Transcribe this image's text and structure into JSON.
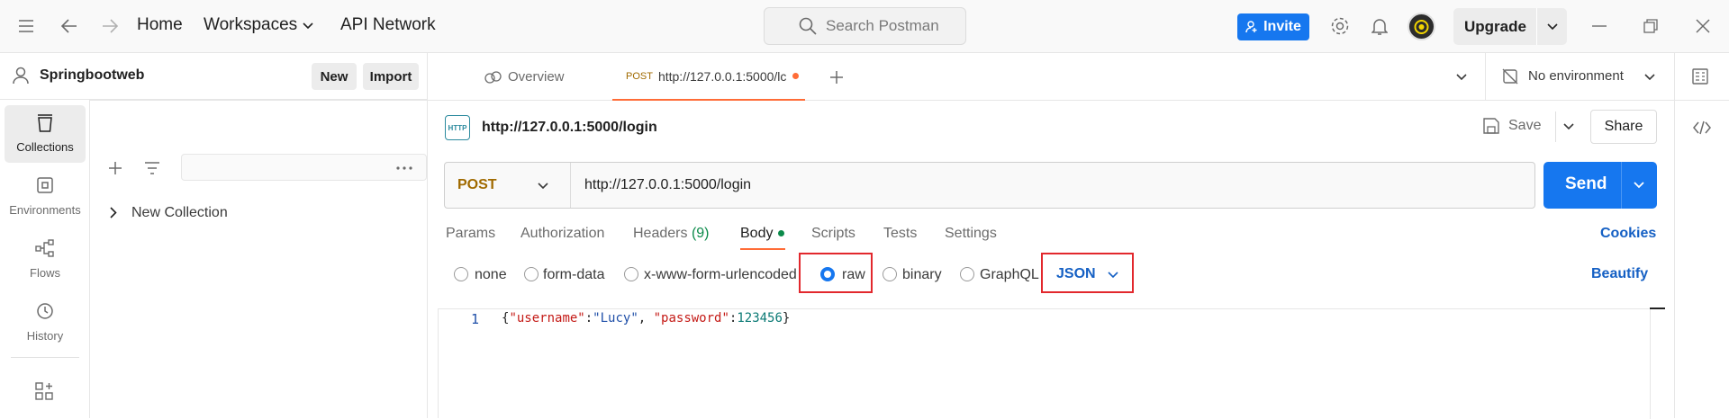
{
  "topbar": {
    "nav": {
      "home": "Home",
      "workspaces": "Workspaces",
      "api_network": "API Network"
    },
    "search_placeholder": "Search Postman",
    "invite": "Invite",
    "upgrade": "Upgrade"
  },
  "rail": {
    "items": [
      {
        "label": "Collections",
        "icon": "collections-icon"
      },
      {
        "label": "Environments",
        "icon": "environments-icon"
      },
      {
        "label": "Flows",
        "icon": "flows-icon"
      },
      {
        "label": "History",
        "icon": "history-icon"
      }
    ]
  },
  "sidebar": {
    "workspace_name": "Springbootweb",
    "new_btn": "New",
    "import_btn": "Import",
    "collection": "New Collection"
  },
  "tabs": {
    "overview": "Overview",
    "active_method": "POST",
    "active_url": "http://127.0.0.1:5000/lc",
    "environment": "No environment"
  },
  "request": {
    "title": "http://127.0.0.1:5000/login",
    "save": "Save",
    "share": "Share",
    "method": "POST",
    "url": "http://127.0.0.1:5000/login",
    "send": "Send",
    "tabs": {
      "params": "Params",
      "authorization": "Authorization",
      "headers": "Headers",
      "headers_count": "(9)",
      "body": "Body",
      "scripts": "Scripts",
      "tests": "Tests",
      "settings": "Settings"
    },
    "cookies": "Cookies",
    "body_types": {
      "none": "none",
      "form_data": "form-data",
      "urlencoded": "x-www-form-urlencoded",
      "raw": "raw",
      "binary": "binary",
      "graphql": "GraphQL"
    },
    "format": "JSON",
    "beautify": "Beautify"
  },
  "editor": {
    "line_number": "1",
    "tokens": {
      "brace_open": "{",
      "key1": "\"username\"",
      "colon1": ":",
      "val1": "\"Lucy\"",
      "comma": ", ",
      "key2": "\"password\"",
      "colon2": ":",
      "val2": "123456",
      "brace_close": "}"
    }
  },
  "colors": {
    "accent": "#1677ef",
    "method": "#a06a00",
    "highlight": "#e2282d",
    "json_key": "#c41a16",
    "json_string": "#1f4fa8",
    "json_number": "#0b7a75"
  }
}
